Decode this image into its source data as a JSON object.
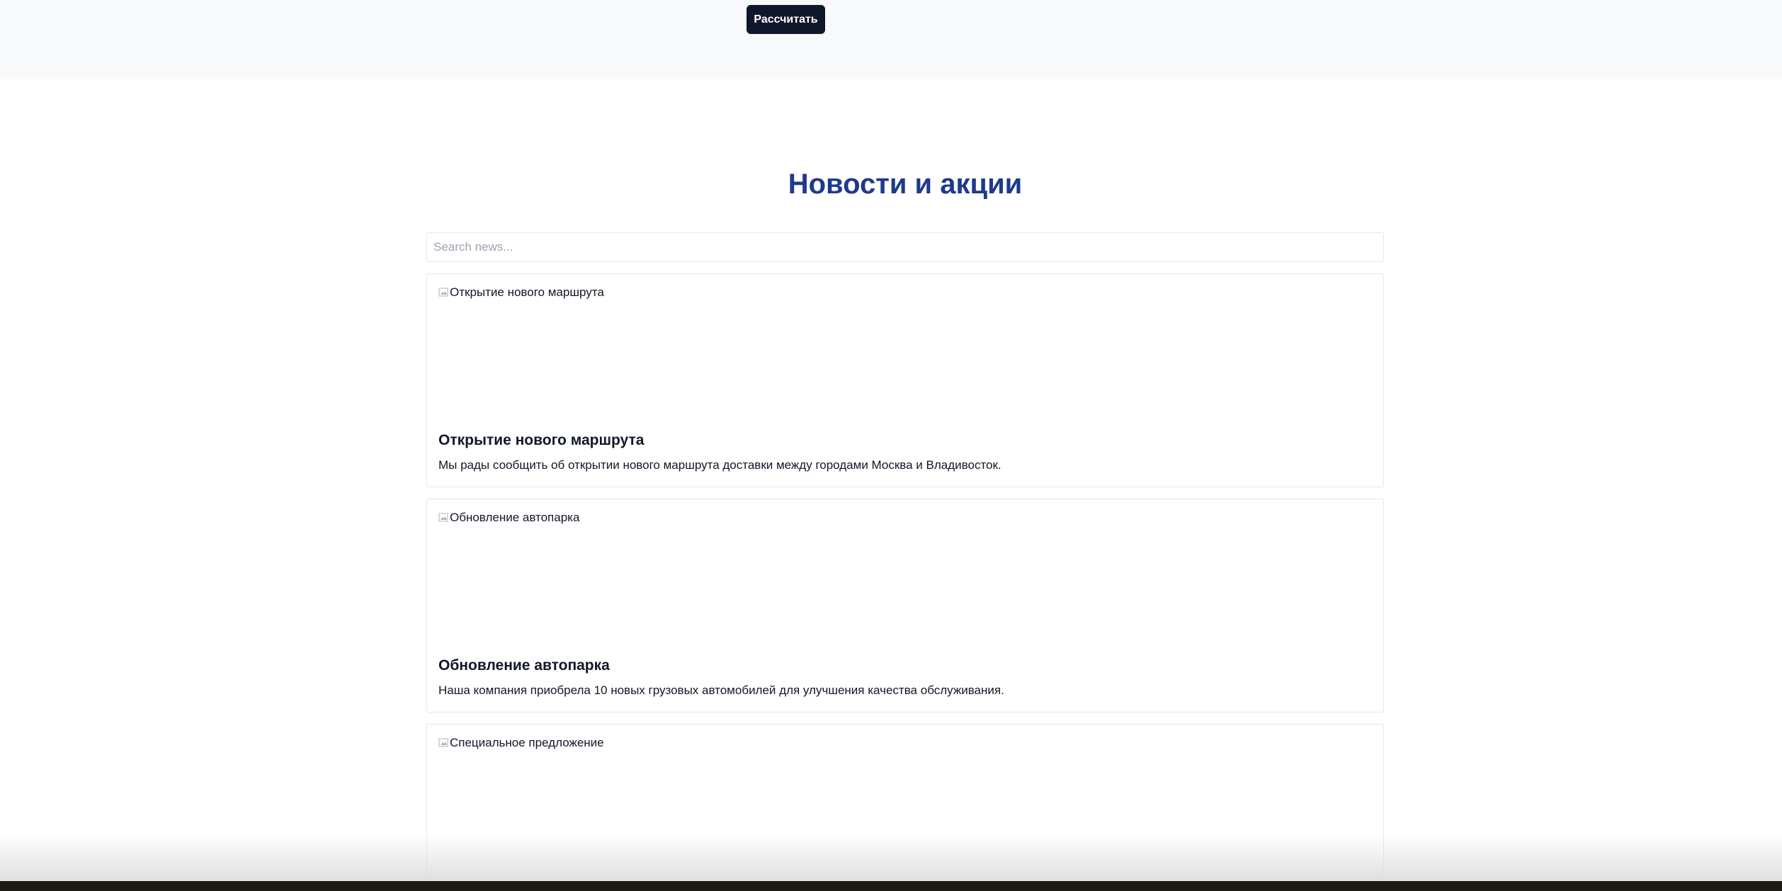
{
  "calculator": {
    "calculate_label": "Рассчитать"
  },
  "news": {
    "title": "Новости и акции",
    "search_placeholder": "Search news...",
    "items": [
      {
        "image_alt": "Открытие нового маршрута",
        "title": "Открытие нового маршрута",
        "text": "Мы рады сообщить об открытии нового маршрута доставки между городами Москва и Владивосток."
      },
      {
        "image_alt": "Обновление автопарка",
        "title": "Обновление автопарка",
        "text": "Наша компания приобрела 10 новых грузовых автомобилей для улучшения качества обслуживания."
      },
      {
        "image_alt": "Специальное предложение"
      }
    ]
  },
  "icons": {
    "broken_image": "broken-image-icon"
  }
}
